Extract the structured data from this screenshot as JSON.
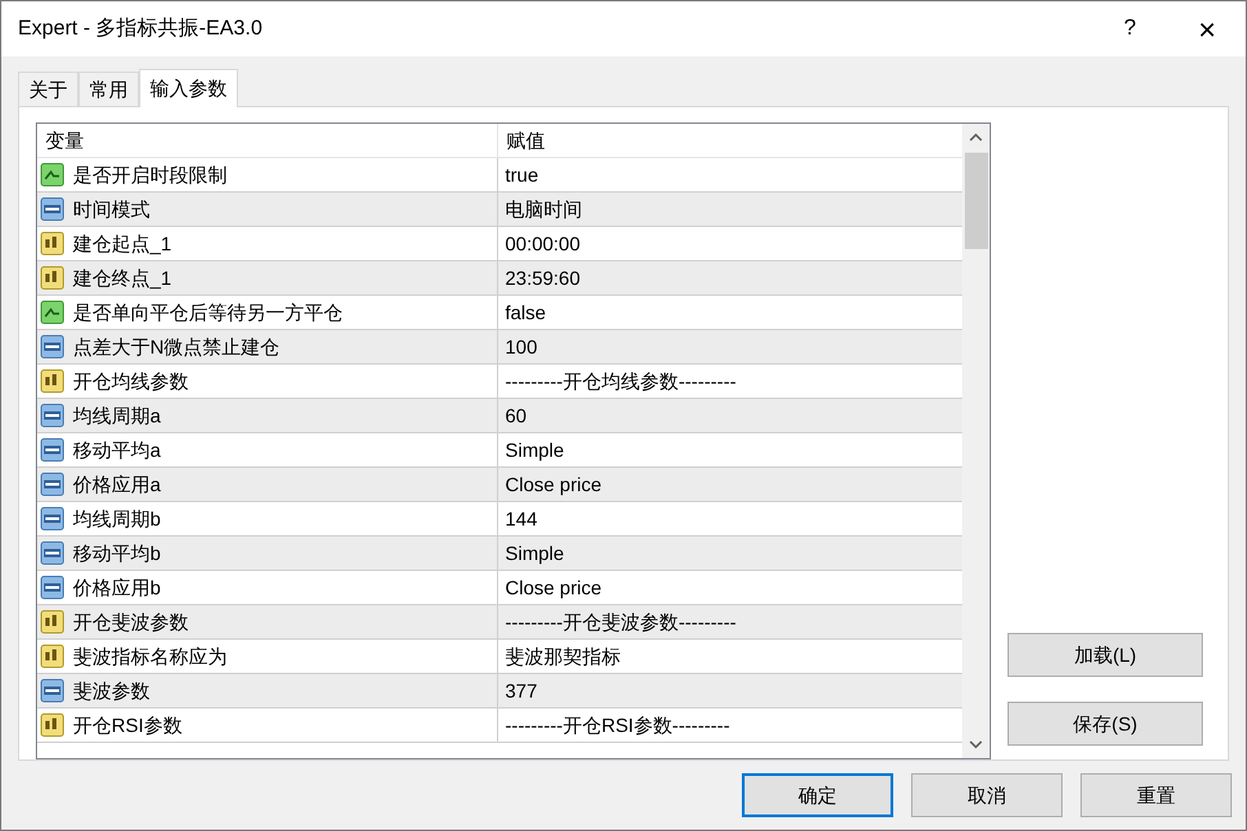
{
  "window": {
    "title": "Expert - 多指标共振-EA3.0",
    "help": "?",
    "close": "×"
  },
  "tabs": [
    {
      "label": "关于",
      "selected": false
    },
    {
      "label": "常用",
      "selected": false
    },
    {
      "label": "输入参数",
      "selected": true
    }
  ],
  "table": {
    "columns": [
      "变量",
      "赋值"
    ],
    "rows": [
      {
        "kind": "bool",
        "name": "是否开启时段限制",
        "value": "true"
      },
      {
        "kind": "int",
        "name": "时间模式",
        "value": "电脑时间"
      },
      {
        "kind": "string",
        "name": "建仓起点_1",
        "value": "00:00:00"
      },
      {
        "kind": "string",
        "name": "建仓终点_1",
        "value": "23:59:60"
      },
      {
        "kind": "bool",
        "name": "是否单向平仓后等待另一方平仓",
        "value": "false"
      },
      {
        "kind": "int",
        "name": "点差大于N微点禁止建仓",
        "value": "100"
      },
      {
        "kind": "string",
        "name": "开仓均线参数",
        "value": "---------开仓均线参数---------"
      },
      {
        "kind": "int",
        "name": "均线周期a",
        "value": "60"
      },
      {
        "kind": "int",
        "name": "移动平均a",
        "value": "Simple"
      },
      {
        "kind": "int",
        "name": "价格应用a",
        "value": "Close price"
      },
      {
        "kind": "int",
        "name": "均线周期b",
        "value": "144"
      },
      {
        "kind": "int",
        "name": "移动平均b",
        "value": "Simple"
      },
      {
        "kind": "int",
        "name": "价格应用b",
        "value": "Close price"
      },
      {
        "kind": "string",
        "name": "开仓斐波参数",
        "value": "---------开仓斐波参数---------"
      },
      {
        "kind": "string",
        "name": "斐波指标名称应为",
        "value": "斐波那契指标"
      },
      {
        "kind": "int",
        "name": "斐波参数",
        "value": "377"
      },
      {
        "kind": "string",
        "name": "开仓RSI参数",
        "value": "---------开仓RSI参数---------"
      }
    ]
  },
  "side_buttons": [
    "加载(L)",
    "保存(S)"
  ],
  "buttons": [
    {
      "label": "确定",
      "default": true
    },
    {
      "label": "取消",
      "default": false
    },
    {
      "label": "重置",
      "default": false
    }
  ]
}
